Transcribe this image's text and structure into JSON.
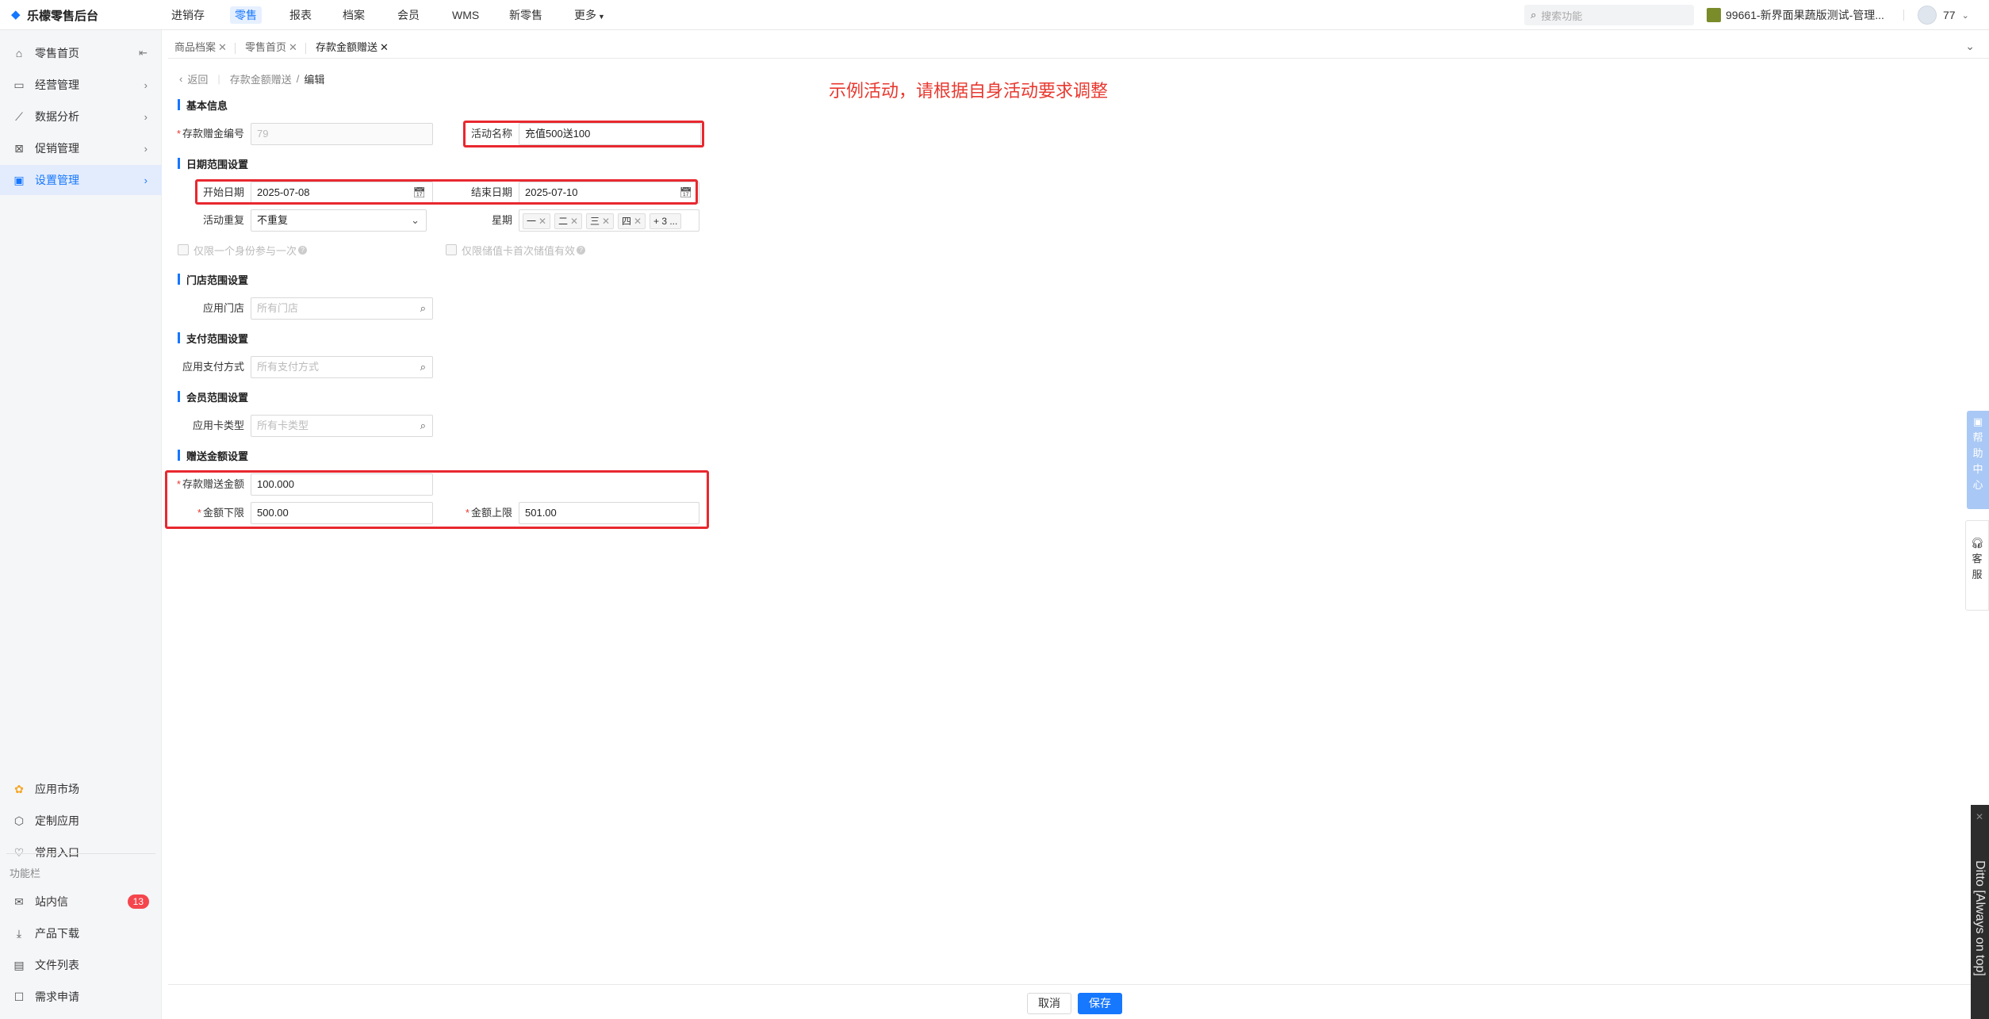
{
  "app": {
    "title": "乐檬零售后台"
  },
  "topnav": {
    "items": [
      "进销存",
      "零售",
      "报表",
      "档案",
      "会员",
      "WMS",
      "新零售",
      "更多"
    ],
    "active_index": 1,
    "search_placeholder": "搜索功能",
    "store": "99661-新界面果蔬版测试-管理...",
    "user": "77"
  },
  "sidebar": {
    "items": [
      {
        "label": "零售首页",
        "icon": "home-icon"
      },
      {
        "label": "经营管理",
        "icon": "monitor-icon"
      },
      {
        "label": "数据分析",
        "icon": "chart-icon"
      },
      {
        "label": "促销管理",
        "icon": "promo-icon"
      },
      {
        "label": "设置管理",
        "icon": "folder-icon"
      }
    ],
    "active_index": 4,
    "bottom_items": [
      {
        "label": "应用市场",
        "icon": "app-market-icon"
      },
      {
        "label": "定制应用",
        "icon": "cube-icon"
      },
      {
        "label": "常用入口",
        "icon": "heart-icon"
      }
    ],
    "func_caption": "功能栏",
    "func_items": [
      {
        "label": "站内信",
        "icon": "mail-icon",
        "badge": "13"
      },
      {
        "label": "产品下载",
        "icon": "download-icon"
      },
      {
        "label": "文件列表",
        "icon": "file-list-icon"
      },
      {
        "label": "需求申请",
        "icon": "request-icon"
      }
    ]
  },
  "tabs": [
    {
      "label": "商品档案"
    },
    {
      "label": "零售首页"
    },
    {
      "label": "存款金额赠送"
    }
  ],
  "breadcrumb": {
    "back": "返回",
    "parent": "存款金额赠送",
    "sep": "/",
    "current": "编辑"
  },
  "note": "示例活动，请根据自身活动要求调整",
  "form": {
    "basic": {
      "title": "基本信息",
      "code_label": "存款赠金编号",
      "code_value": "79",
      "name_label": "活动名称",
      "name_value": "充值500送100"
    },
    "date": {
      "title": "日期范围设置",
      "start_label": "开始日期",
      "start_value": "2025-07-08",
      "end_label": "结束日期",
      "end_value": "2025-07-10",
      "repeat_label": "活动重复",
      "repeat_value": "不重复",
      "week_label": "星期",
      "week_tags": [
        "一",
        "二",
        "三",
        "四"
      ],
      "week_more": "+ 3 ...",
      "check_once": "仅限一个身份参与一次",
      "check_first": "仅限储值卡首次储值有效"
    },
    "store": {
      "title": "门店范围设置",
      "label": "应用门店",
      "placeholder": "所有门店"
    },
    "pay": {
      "title": "支付范围设置",
      "label": "应用支付方式",
      "placeholder": "所有支付方式"
    },
    "member": {
      "title": "会员范围设置",
      "label": "应用卡类型",
      "placeholder": "所有卡类型"
    },
    "gift": {
      "title": "赠送金额设置",
      "amount_label": "存款赠送金额",
      "amount_value": "100.000",
      "min_label": "金额下限",
      "min_value": "500.00",
      "max_label": "金额上限",
      "max_value": "501.00"
    }
  },
  "floaters": {
    "help": [
      "帮",
      "助",
      "中",
      "心"
    ],
    "service": [
      "客",
      "服"
    ],
    "ditto": "Ditto [Always on top]"
  },
  "footer": {
    "cancel": "取消",
    "save": "保存"
  },
  "colors": {
    "accent": "#1677ff",
    "annotation": "#e8382f"
  }
}
